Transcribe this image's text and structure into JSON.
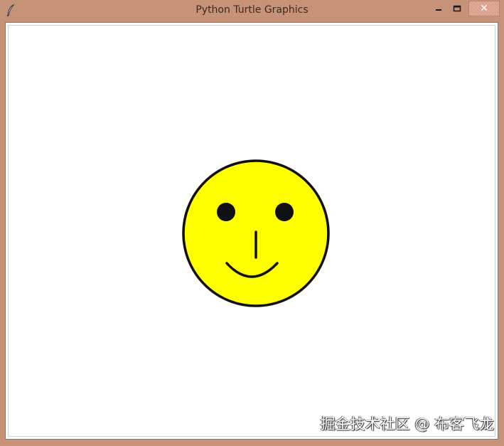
{
  "window": {
    "title": "Python Turtle Graphics",
    "controls": {
      "minimize_icon": "minimize-icon",
      "maximize_icon": "maximize-icon",
      "close_glyph": "✕"
    }
  },
  "drawing": {
    "face_fill": "#ffff00",
    "outline_color": "#111111",
    "eye_color": "#111111"
  },
  "watermark": "掘金技术社区 @ 布客飞龙"
}
